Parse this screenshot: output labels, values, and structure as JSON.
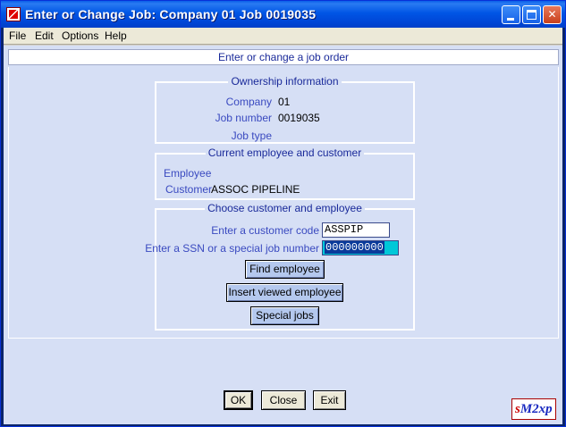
{
  "window": {
    "title": "Enter or Change Job:  Company 01 Job 0019035",
    "minimize_glyph": "",
    "maximize_glyph": "",
    "close_glyph": "✕"
  },
  "menu": {
    "items": [
      {
        "label": "File"
      },
      {
        "label": "Edit"
      },
      {
        "label": "Options"
      },
      {
        "label": "Help"
      }
    ]
  },
  "header": {
    "title": "Enter or change a job order"
  },
  "ownership": {
    "title": "Ownership information",
    "company_label": "Company",
    "company_value": "01",
    "job_number_label": "Job number",
    "job_number_value": "0019035",
    "job_type_label": "Job type",
    "job_type_value": ""
  },
  "current": {
    "title": "Current employee and customer",
    "employee_label": "Employee",
    "employee_value": "",
    "customer_label": "Customer",
    "customer_value": "ASSOC PIPELINE"
  },
  "choose": {
    "title": "Choose customer and employee",
    "customer_code_label": "Enter a customer code",
    "customer_code_value": "ASSPIP",
    "ssn_label": "Enter a SSN or a special job number",
    "ssn_value": "000000000",
    "find_employee": "Find employee",
    "insert_viewed": "Insert viewed employee",
    "special_jobs": "Special jobs"
  },
  "footer": {
    "ok": "OK",
    "close": "Close",
    "exit": "Exit"
  },
  "logo": {
    "text_s": "s",
    "text_rest": "M2xp"
  },
  "colors": {
    "titlebar": "#0055e5",
    "body": "#d6dff5",
    "label": "#3a4ac0",
    "button": "#b4c8ee",
    "ssn_highlight": "#00c8d8"
  }
}
